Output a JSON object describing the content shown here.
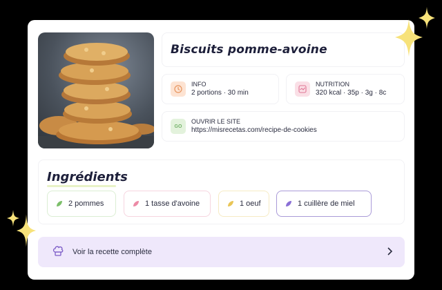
{
  "recipe": {
    "title": "Biscuits pomme-avoine",
    "photo_alt": "stack of oat cookies"
  },
  "info": {
    "label": "INFO",
    "value": "2 portions · 30 min",
    "icon": "clock-icon"
  },
  "nutrition": {
    "label": "NUTRITION",
    "value": "320 kcal · 35p · 3g · 8c",
    "icon": "chart-icon"
  },
  "site": {
    "label": "OUVRIR LE SITE",
    "url": "https://misrecetas.com/recipe-de-cookies",
    "icon": "go-link-icon",
    "icon_text": "GO"
  },
  "ingredients": {
    "title": "Ingrédients",
    "items": [
      {
        "label": "2 pommes",
        "color": "#7cbf6a"
      },
      {
        "label": "1 tasse d'avoine",
        "color": "#ec8aa6"
      },
      {
        "label": "1 oeuf",
        "color": "#e9c556"
      },
      {
        "label": "1 cuillère  de miel",
        "color": "#8a6fd6"
      }
    ]
  },
  "cta": {
    "label": "Voir la recette complète",
    "icon": "chef-hat-icon"
  },
  "colors": {
    "accent_purple": "#efe8fb",
    "info_icon_bg": "#fde3d2",
    "nutrition_icon_bg": "#fadfe6",
    "site_icon_bg": "#e3f2dc",
    "sparkle": "#f7e27a"
  }
}
